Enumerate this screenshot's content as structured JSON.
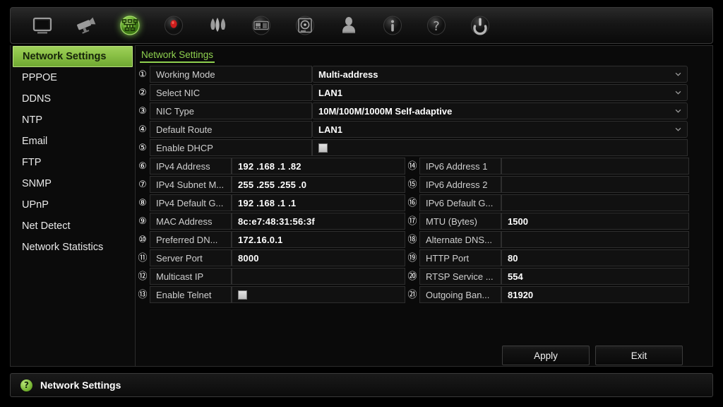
{
  "toolbar": {
    "icons": [
      {
        "name": "monitor-icon",
        "label": "Live View",
        "active": false
      },
      {
        "name": "camera-icon",
        "label": "Camera",
        "active": false
      },
      {
        "name": "network-icon",
        "label": "Network",
        "active": true
      },
      {
        "name": "record-icon",
        "label": "Record",
        "active": false
      },
      {
        "name": "alarm-icon",
        "label": "Alarm",
        "active": false
      },
      {
        "name": "device-icon",
        "label": "Device",
        "active": false
      },
      {
        "name": "hdd-icon",
        "label": "HDD",
        "active": false
      },
      {
        "name": "user-icon",
        "label": "User",
        "active": false
      },
      {
        "name": "info-icon",
        "label": "System Info",
        "active": false
      },
      {
        "name": "help-icon",
        "label": "Help",
        "active": false
      },
      {
        "name": "power-icon",
        "label": "Shutdown",
        "active": false
      }
    ]
  },
  "sidebar": {
    "items": [
      {
        "label": "Network Settings",
        "selected": true
      },
      {
        "label": "PPPOE",
        "selected": false
      },
      {
        "label": "DDNS",
        "selected": false
      },
      {
        "label": "NTP",
        "selected": false
      },
      {
        "label": "Email",
        "selected": false
      },
      {
        "label": "FTP",
        "selected": false
      },
      {
        "label": "SNMP",
        "selected": false
      },
      {
        "label": "UPnP",
        "selected": false
      },
      {
        "label": "Net Detect",
        "selected": false
      },
      {
        "label": "Network Statistics",
        "selected": false
      }
    ]
  },
  "tab": {
    "label": "Network Settings"
  },
  "form": {
    "selects": [
      {
        "badge": "①",
        "label": "Working Mode",
        "value": "Multi-address"
      },
      {
        "badge": "②",
        "label": "Select NIC",
        "value": "LAN1"
      },
      {
        "badge": "③",
        "label": "NIC Type",
        "value": "10M/100M/1000M Self-adaptive"
      },
      {
        "badge": "④",
        "label": "Default Route",
        "value": "LAN1"
      }
    ],
    "dhcp": {
      "badge": "⑤",
      "label": "Enable DHCP",
      "checked": false
    },
    "pairs": [
      {
        "lbadge": "⑥",
        "llabel": "IPv4 Address",
        "lvalue": "192 .168 .1    .82",
        "rbadge": "⑭",
        "rlabel": "IPv6 Address 1",
        "rvalue": ""
      },
      {
        "lbadge": "⑦",
        "llabel": "IPv4 Subnet M...",
        "lvalue": "255 .255 .255 .0",
        "rbadge": "⑮",
        "rlabel": "IPv6 Address 2",
        "rvalue": ""
      },
      {
        "lbadge": "⑧",
        "llabel": "IPv4 Default G...",
        "lvalue": "192 .168 .1    .1",
        "rbadge": "⑯",
        "rlabel": "IPv6 Default G...",
        "rvalue": ""
      },
      {
        "lbadge": "⑨",
        "llabel": "MAC Address",
        "lvalue": "8c:e7:48:31:56:3f",
        "rbadge": "⑰",
        "rlabel": "MTU (Bytes)",
        "rvalue": "1500"
      },
      {
        "lbadge": "⑩",
        "llabel": "Preferred DN...",
        "lvalue": "172.16.0.1",
        "rbadge": "⑱",
        "rlabel": "Alternate DNS...",
        "rvalue": ""
      },
      {
        "lbadge": "⑪",
        "llabel": "Server Port",
        "lvalue": "8000",
        "rbadge": "⑲",
        "rlabel": "HTTP Port",
        "rvalue": "80"
      },
      {
        "lbadge": "⑫",
        "llabel": "Multicast IP",
        "lvalue": "",
        "rbadge": "⑳",
        "rlabel": "RTSP Service ...",
        "rvalue": "554"
      },
      {
        "lbadge": "⑬",
        "llabel": "Enable Telnet",
        "lvalue": "",
        "rbadge": "㉑",
        "rlabel": "Outgoing Ban...",
        "rvalue": "81920"
      }
    ],
    "telnet_checked": false
  },
  "buttons": {
    "apply": "Apply",
    "exit": "Exit"
  },
  "status": {
    "icon": "?",
    "text": "Network Settings"
  },
  "colors": {
    "accent_green": "#8fd14f",
    "panel_bg": "#0a0a0a",
    "cell_bg": "#111111",
    "border": "#2e2e2e"
  }
}
